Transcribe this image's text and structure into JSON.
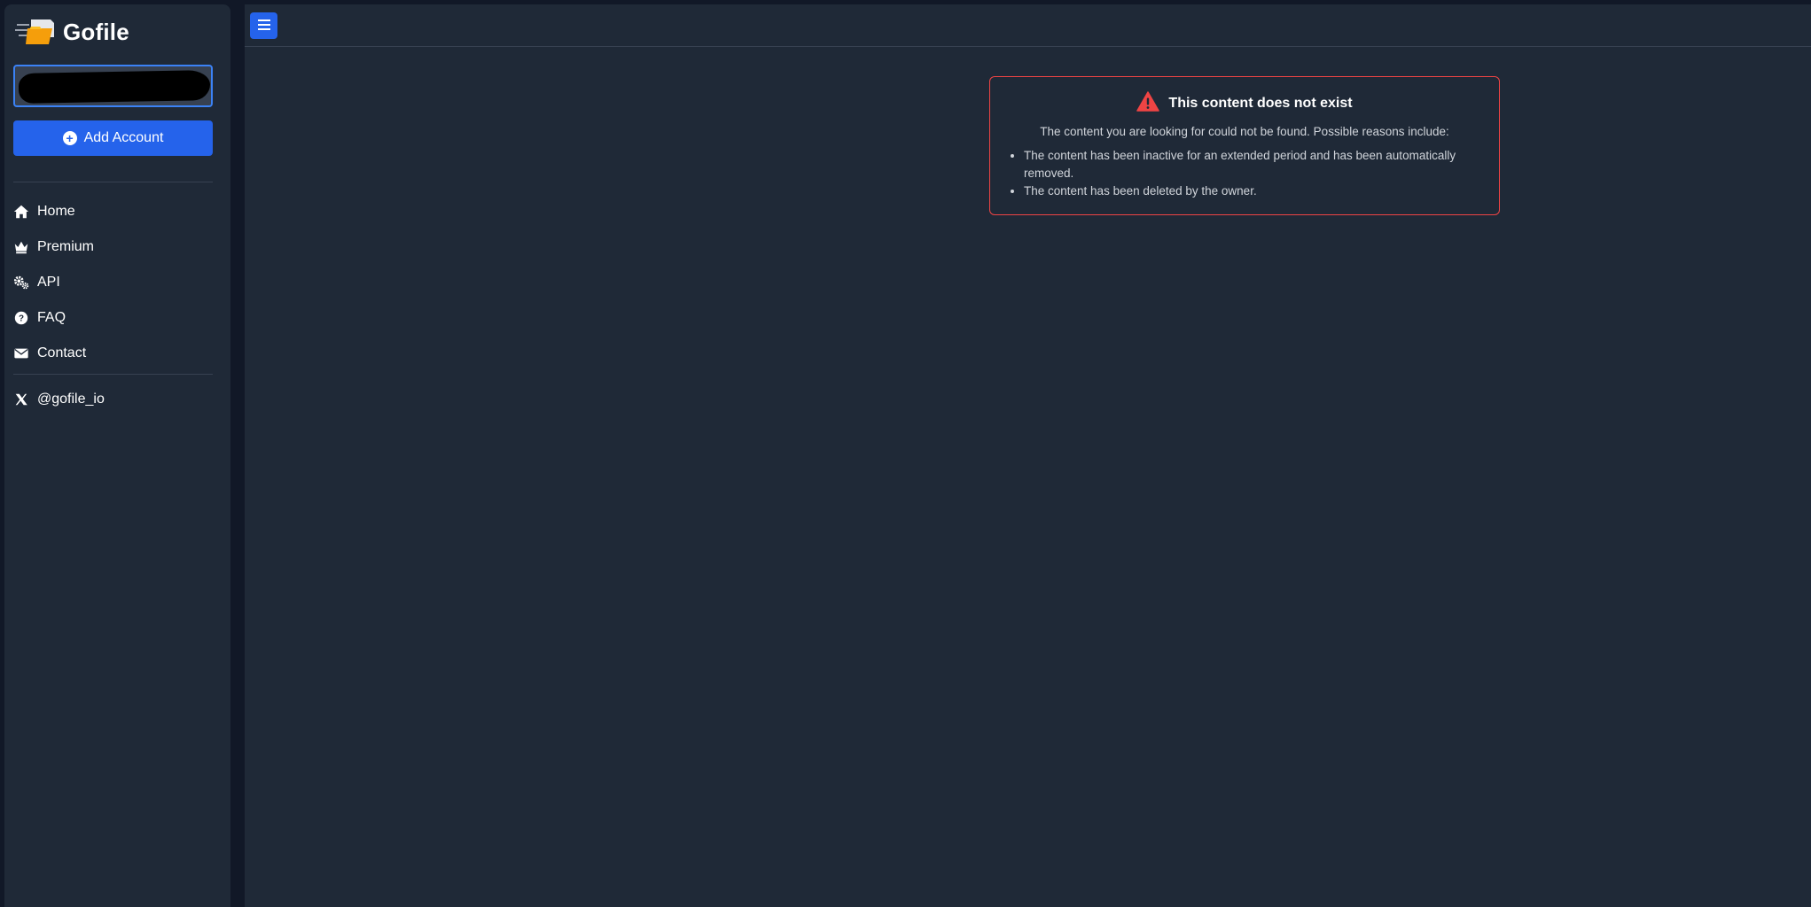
{
  "brand": {
    "name": "Gofile",
    "icon": "gofile-logo-icon"
  },
  "account": {
    "value": ""
  },
  "sidebar": {
    "add_account_label": "Add Account",
    "nav": [
      {
        "label": "Home",
        "icon": "home-icon"
      },
      {
        "label": "Premium",
        "icon": "crown-icon"
      },
      {
        "label": "API",
        "icon": "gears-icon"
      },
      {
        "label": "FAQ",
        "icon": "question-circle-icon"
      },
      {
        "label": "Contact",
        "icon": "envelope-icon"
      }
    ],
    "social": {
      "label": "@gofile_io",
      "icon": "x-logo-icon"
    }
  },
  "topbar": {
    "menu_icon": "hamburger-icon"
  },
  "error": {
    "title": "This content does not exist",
    "description": "The content you are looking for could not be found. Possible reasons include:",
    "reasons": [
      "The content has been inactive for an extended period and has been automatically removed.",
      "The content has been deleted by the owner."
    ]
  },
  "colors": {
    "accent": "#2563eb",
    "error_border": "#ef4444",
    "panel": "#1f2937",
    "background": "#111827"
  }
}
